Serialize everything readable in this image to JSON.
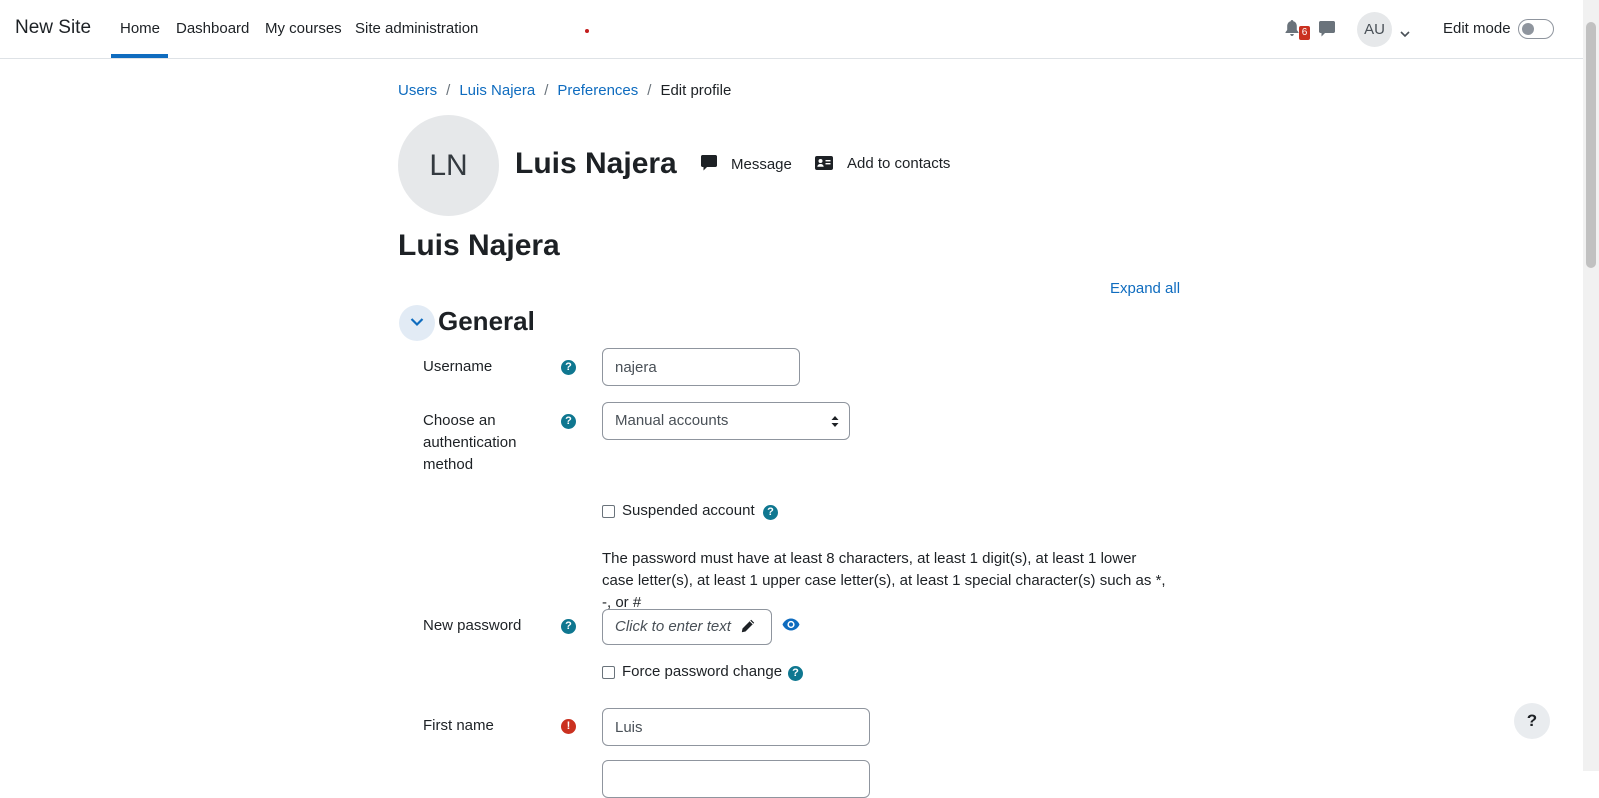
{
  "navbar": {
    "brand": "New Site",
    "links": [
      "Home",
      "Dashboard",
      "My courses",
      "Site administration"
    ],
    "active_link": "Home",
    "notification_count": "6",
    "user_initials": "AU",
    "edit_mode_label": "Edit mode",
    "edit_mode_on": false
  },
  "breadcrumb": {
    "items": [
      "Users",
      "Luis Najera",
      "Preferences"
    ],
    "current": "Edit profile"
  },
  "profile": {
    "initials": "LN",
    "name": "Luis Najera",
    "message_label": "Message",
    "add_contacts_label": "Add to contacts"
  },
  "page_title": "Luis Najera",
  "expand_all_label": "Expand all",
  "section": {
    "title": "General",
    "expanded": true
  },
  "form": {
    "username_label": "Username",
    "username_value": "najera",
    "auth_label": "Choose an authentication method",
    "auth_value": "Manual accounts",
    "suspended_label": "Suspended account",
    "suspended_checked": false,
    "password_rule": "The password must have at least 8 characters, at least 1 digit(s), at least 1 lower case letter(s), at least 1 upper case letter(s), at least 1 special character(s) such as *, -, or #",
    "new_password_label": "New password",
    "new_password_placeholder": "Click to enter text",
    "force_change_label": "Force password change",
    "force_change_checked": false,
    "first_name_label": "First name",
    "first_name_value": "Luis"
  },
  "colors": {
    "link": "#0f6cbf",
    "help_icon": "#0f7790",
    "required_icon": "#ca3120"
  }
}
